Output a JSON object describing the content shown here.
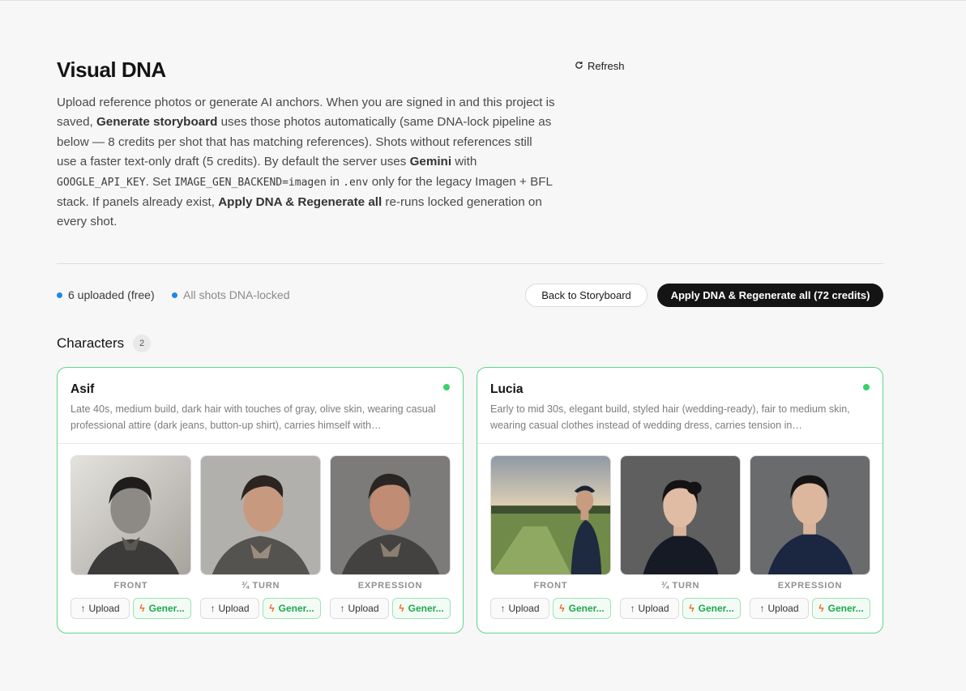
{
  "header": {
    "title": "Visual DNA",
    "refresh_label": "Refresh"
  },
  "description": {
    "t1": "Upload reference photos or generate AI anchors. When you are signed in and this project is saved, ",
    "b1": "Generate storyboard",
    "t2": " uses those photos automatically (same DNA-lock pipeline as below — 8 credits per shot that has matching references). Shots without references still use a faster text-only draft (5 credits). By default the server uses ",
    "b2": "Gemini",
    "t3": " with ",
    "c1": "GOOGLE_API_KEY",
    "t4": ". Set ",
    "c2": "IMAGE_GEN_BACKEND=imagen",
    "t5": " in ",
    "c3": ".env",
    "t6": " only for the legacy Imagen + BFL stack. If panels already exist, ",
    "b3": "Apply DNA & Regenerate all",
    "t7": " re-runs locked generation on every shot."
  },
  "status": {
    "uploaded": "6 uploaded (free)",
    "locked": "All shots DNA-locked"
  },
  "actions": {
    "back": "Back to Storyboard",
    "apply": "Apply DNA & Regenerate all (72 credits)"
  },
  "characters_section": {
    "title": "Characters",
    "count": "2"
  },
  "characters": [
    {
      "name": "Asif",
      "description": "Late 40s, medium build, dark hair with touches of gray, olive skin, wearing casual professional attire (dark jeans, button-up shirt), carries himself with…",
      "slots": [
        {
          "label": "FRONT",
          "upload": "Upload",
          "generate": "Gener..."
        },
        {
          "label": "¾ TURN",
          "upload": "Upload",
          "generate": "Gener..."
        },
        {
          "label": "EXPRESSION",
          "upload": "Upload",
          "generate": "Gener..."
        }
      ]
    },
    {
      "name": "Lucia",
      "description": "Early to mid 30s, elegant build, styled hair (wedding-ready), fair to medium skin, wearing casual clothes instead of wedding dress, carries tension in…",
      "slots": [
        {
          "label": "FRONT",
          "upload": "Upload",
          "generate": "Gener..."
        },
        {
          "label": "¾ TURN",
          "upload": "Upload",
          "generate": "Gener..."
        },
        {
          "label": "EXPRESSION",
          "upload": "Upload",
          "generate": "Gener..."
        }
      ]
    }
  ],
  "icons": {
    "refresh": "refresh-icon",
    "upload": "upload-arrow-icon",
    "generate": "lightning-bolt-icon",
    "status": "status-dot-icon"
  },
  "colors": {
    "accent_dark": "#141414",
    "card_border": "#5fd58a",
    "status_dot": "#1e88e5",
    "generate_text": "#20a650",
    "bolt": "#f26522"
  }
}
